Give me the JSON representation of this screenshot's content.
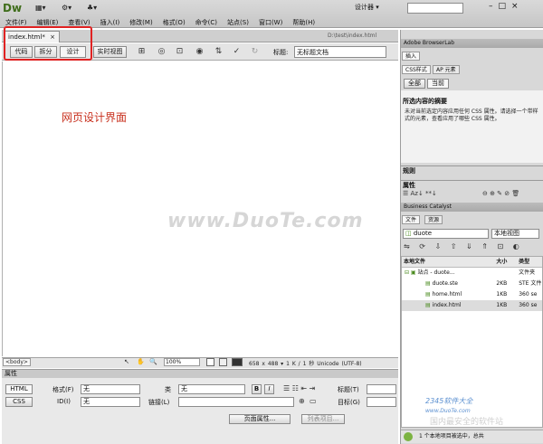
{
  "app": {
    "logo": "Dw",
    "workspace_label": "设计器 ▾"
  },
  "menu": [
    "文件(F)",
    "编辑(E)",
    "查看(V)",
    "插入(I)",
    "修改(M)",
    "格式(O)",
    "命令(C)",
    "站点(S)",
    "窗口(W)",
    "帮助(H)"
  ],
  "document": {
    "tab_label": "index.html*",
    "tab_close": "×",
    "path": "D:\\test\\index.html",
    "view_buttons": [
      "代码",
      "拆分",
      "设计",
      "实时视图"
    ],
    "title_label": "标题:",
    "title_value": "无标题文档",
    "design_text": "网页设计界面",
    "watermark": "www.DuoTe.com"
  },
  "status": {
    "tag": "<body>",
    "zoom": "100%",
    "info": "658 x 488 ▾  1 K / 1 秒  Unicode (UTF-8)"
  },
  "properties": {
    "title": "属性",
    "html_label": "HTML",
    "css_label": "CSS",
    "format_label": "格式(F)",
    "format_value": "无",
    "id_label": "ID(I)",
    "id_value": "无",
    "class_label": "类",
    "class_value": "无",
    "link_label": "链接(L)",
    "bold": "B",
    "italic": "I",
    "title_label": "标题(T)",
    "target_label": "目标(G)",
    "page_props_button": "页面属性...",
    "list_item_button": "列表项目..."
  },
  "right": {
    "browserlab": "Adobe BrowserLab",
    "insert_tab": "插入",
    "css_tabs": [
      "CSS样式",
      "AP 元素"
    ],
    "css_mode_buttons": [
      "全部",
      "当前"
    ],
    "css_summary_title": "所选内容的摘要",
    "css_summary_text": "未对当前选定内容应用任何 CSS 属性。请选择一个带样式的元素，查看应用了哪些 CSS 属性。",
    "rules_label": "规则",
    "attributes_label": "属性",
    "catalyst": "Business Catalyst",
    "file_tabs": [
      "文件",
      "资源"
    ],
    "site_select": "duote",
    "view_select": "本地视图",
    "file_columns": [
      "本地文件",
      "大小",
      "类型"
    ],
    "files": [
      {
        "name": "站点 - duote...",
        "size": "",
        "type": "文件夹"
      },
      {
        "name": "duote.ste",
        "size": "2KB",
        "type": "STE 文件"
      },
      {
        "name": "home.html",
        "size": "1KB",
        "type": "360 se"
      },
      {
        "name": "index.html",
        "size": "1KB",
        "type": "360 se"
      }
    ],
    "status_text": "1 个本地项目被选中，总共",
    "corner_watermark": "2345软件大全",
    "corner_url": "www.DuoTe.com",
    "bottom_watermark": "国内最安全的软件站"
  }
}
